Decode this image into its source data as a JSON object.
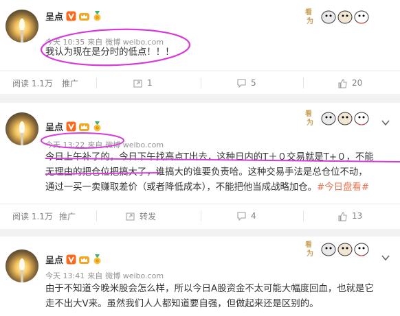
{
  "colors": {
    "annotation": "#d73ad9",
    "hashtag": "#eb7350",
    "meta": "#939393",
    "background": "#f2f2f2"
  },
  "posts": [
    {
      "username": "呈点",
      "time": "今天 10:35",
      "source_prefix": "来自",
      "source": "微博 weibo.com",
      "text": "我认为现在是分时的低点！！！",
      "reads_label": "阅读 1.1万",
      "promote_label": "推广",
      "repost_count": "1",
      "comment_count": "5",
      "like_count": "20"
    },
    {
      "username": "呈点",
      "time": "今天 13:22",
      "source_prefix": "来自",
      "source": "微博 weibo.com",
      "text_line1": "今日上午补了的，今日下午找高点T出去，这种日内的T＋０交易就是T+０，不能",
      "text_line2": "无理由的把仓位把搞大了，谁搞大的谁要负责哈。这种交易手法是总仓位不动，",
      "text_line3": "通过一买一卖赚取差价（或者降低成本），不能把他当成战略加仓。",
      "hashtag": "#今日盘看#",
      "reads_label": "阅读 1.1万",
      "promote_label": "推广",
      "repost_label": "转发",
      "comment_count": "4",
      "like_count": "13"
    },
    {
      "username": "呈点",
      "time": "今天 13:41",
      "source_prefix": "来自",
      "source": "微博 weibo.com",
      "text_line1": "由于不知道今晚米股会怎么样，所以今日A股资金不太可能大幅度回血，也就是它",
      "text_line2": "走不出大V来。虽然我们人人都知道要自强，但做起来还是区别的。"
    }
  ],
  "icons": {
    "verified": "verified-v-icon",
    "crown": "crown-icon",
    "medal": "medal-icon",
    "sticker": "cat-sticker",
    "repost": "repost-icon",
    "comment": "comment-icon",
    "like": "like-icon",
    "chevron": "chevron-down-icon"
  }
}
